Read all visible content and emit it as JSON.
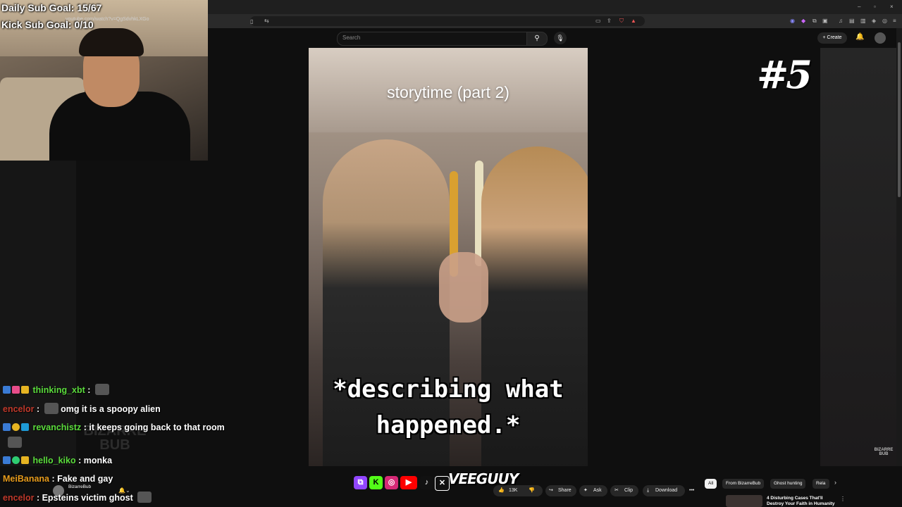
{
  "overlay": {
    "daily_goal": "Daily Sub Goal: 15/67",
    "kick_goal": "Kick Sub Goal: 0/10",
    "badge": "#5",
    "watermark_right": "BIZARRE BUB",
    "watermark_left": "BIZARRE BUB"
  },
  "browser": {
    "url": "youtube.com/watch?v=QgSdvhkLXGo"
  },
  "youtube": {
    "search_placeholder": "Search",
    "create_label": "Create",
    "video_title_text": "storytime (part 2)",
    "video_caption": "*describing what happened.*",
    "channel_name": "BizarreBub",
    "like_count": "13K",
    "share_label": "Share",
    "ask_label": "Ask",
    "clip_label": "Clip",
    "download_label": "Download",
    "chips": [
      "All",
      "From BizarreBub",
      "Ghost hunting",
      "Rela"
    ],
    "recommended": {
      "title": "4 Disturbing Cases That'll Destroy Your Faith in Humanity"
    }
  },
  "brand": {
    "logo_text": "VEEGUUY"
  },
  "chat": [
    {
      "user": "thinking_xbt",
      "color": "#5bdc3c",
      "message": "",
      "emote": true
    },
    {
      "user": "encelor",
      "color": "#c0392b",
      "message": "omg it is a spoopy alien",
      "emote_before": true
    },
    {
      "user": "revanchistz",
      "color": "#5bdc3c",
      "message": "it keeps going back to that room",
      "emote_after_line": true
    },
    {
      "user": "hello_kiko",
      "color": "#5bdc3c",
      "message": "monka"
    },
    {
      "user": "MeiBanana",
      "color": "#e69b1c",
      "message": "Fake and gay"
    },
    {
      "user": "encelor",
      "color": "#c0392b",
      "message": "Epsteins victim ghost",
      "emote": true
    }
  ],
  "icons": [
    "search-icon",
    "mic-icon",
    "bell-icon",
    "like-icon",
    "dislike-icon",
    "share-icon",
    "ask-icon",
    "clip-icon",
    "download-icon",
    "more-icon",
    "chevron-right-icon"
  ]
}
